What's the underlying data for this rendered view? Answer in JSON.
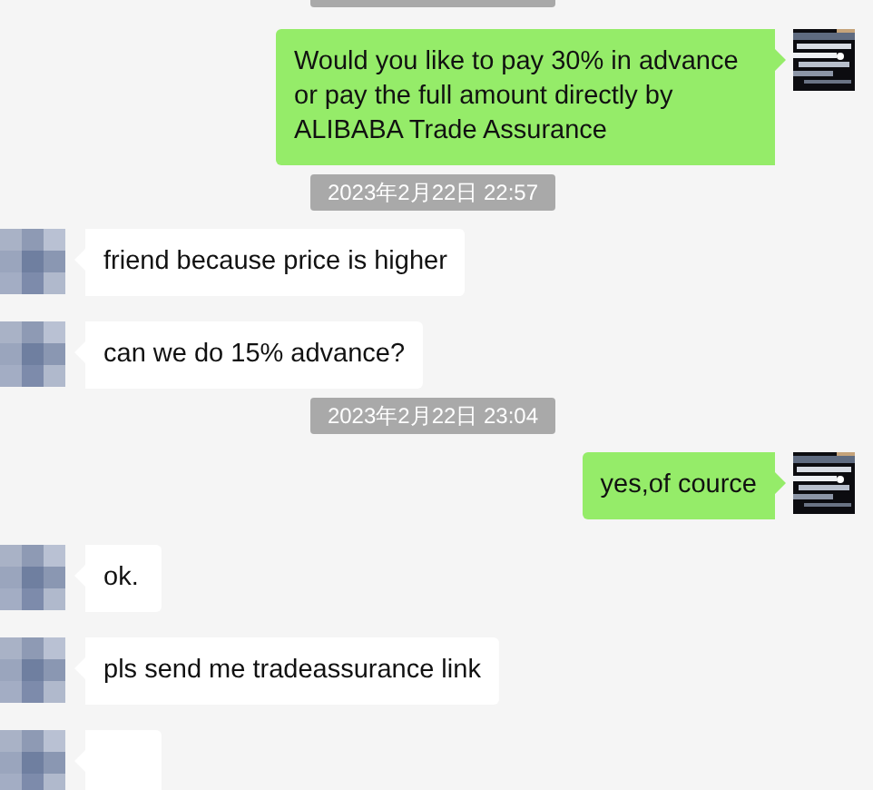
{
  "messages": [
    {
      "kind": "time"
    },
    {
      "kind": "sent",
      "text": "Would you like to pay 30% in advance or pay the full amount directly by ALIBABA Trade Assurance"
    },
    {
      "kind": "time",
      "text": "2023年2月22日 22:57"
    },
    {
      "kind": "received",
      "text": "friend because price is higher"
    },
    {
      "kind": "received",
      "text": "can we do 15% advance?"
    },
    {
      "kind": "time",
      "text": "2023年2月22日 23:04"
    },
    {
      "kind": "sent",
      "text": "yes,of cource"
    },
    {
      "kind": "received",
      "text": "ok."
    },
    {
      "kind": "received",
      "text": "pls send me tradeassurance link"
    },
    {
      "kind": "received"
    }
  ]
}
